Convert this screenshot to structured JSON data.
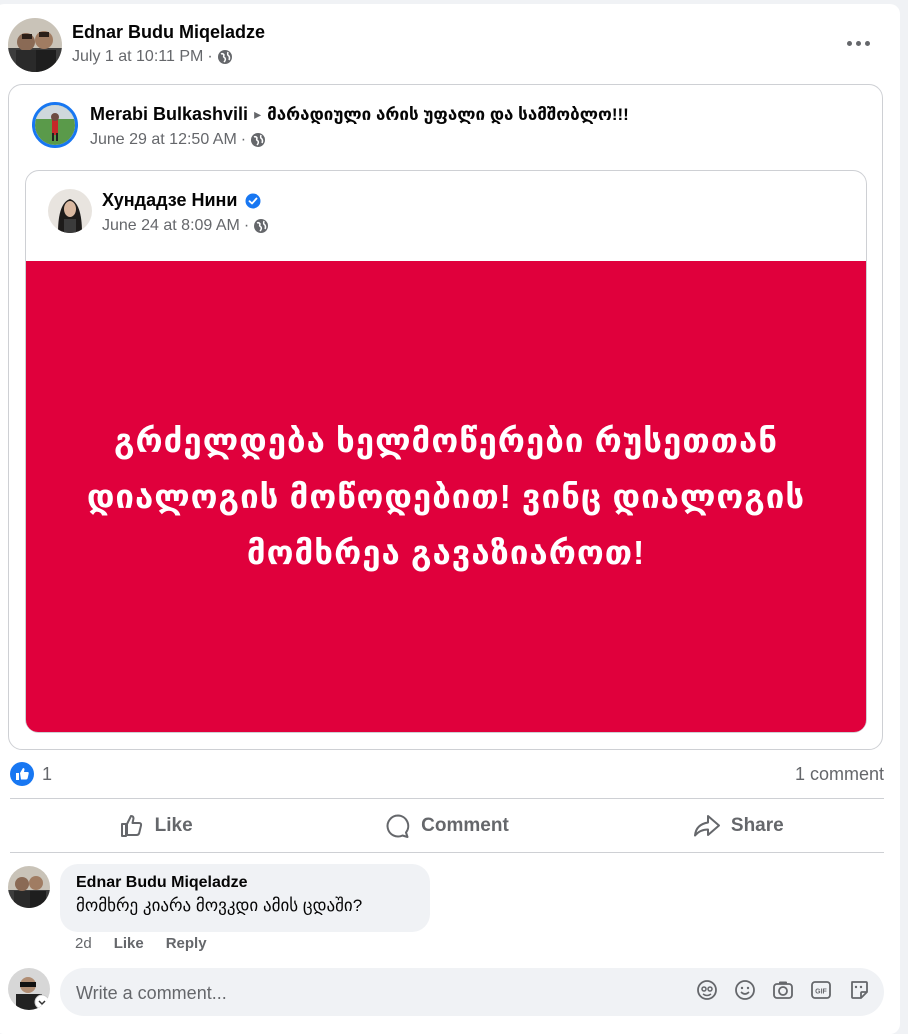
{
  "post": {
    "author": "Ednar Budu Miqeladze",
    "timestamp": "July 1 at 10:11 PM",
    "separator": "·",
    "privacy_icon": "globe-icon",
    "more_icon": "more-options-icon"
  },
  "shared_post": {
    "author": "Merabi Bulkashvili",
    "arrow": "▸",
    "group": "მარადიული არის უფალი და სამშობლო!!!",
    "timestamp": "June 29 at 12:50 AM",
    "separator": "·"
  },
  "original_post": {
    "author": "Хундадзе Нини",
    "verified_icon": "verified-badge-icon",
    "timestamp": "June 24 at 8:09 AM",
    "separator": "·",
    "text": "გრძელდება ხელმოწერები რუსეთთან დიალოგის მოწოდებით! ვინც დიალოგის მომხრეა გავაზიაროთ!",
    "background_color": "#e0003c"
  },
  "stats": {
    "like_count": "1",
    "comment_count": "1 comment"
  },
  "actions": {
    "like": "Like",
    "comment": "Comment",
    "share": "Share"
  },
  "comment": {
    "author": "Ednar Budu Miqeladze",
    "text": "მომხრე კიარა მოვკდი ამის ცდაში?",
    "age": "2d",
    "like": "Like",
    "reply": "Reply"
  },
  "composer": {
    "placeholder": "Write a comment...",
    "tools": [
      "avatar-sticker-icon",
      "emoji-icon",
      "camera-icon",
      "gif-icon",
      "sticker-icon"
    ]
  },
  "colors": {
    "accent": "#1877f2",
    "red_post": "#e0003c",
    "muted_text": "#65676b"
  }
}
